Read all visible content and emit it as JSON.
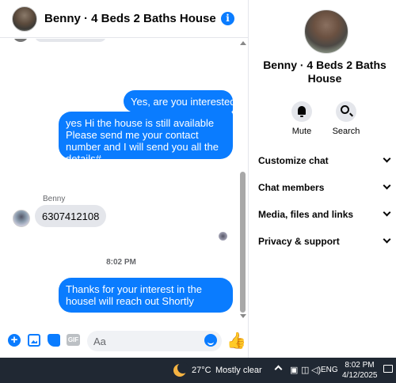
{
  "chat": {
    "title": "Benny · 4 Beds 2 Baths House",
    "messages": [
      {
        "text": "Yes, are you interested?"
      },
      {
        "text": "yes Hi the house is still available Please send me your contact number and I will send you all the details#"
      }
    ],
    "sender_name": "Benny",
    "incoming_text": "6307412108",
    "time_separator": "8:02 PM",
    "last_outgoing": "Thanks for your interest in the housel will reach out Shortly",
    "composer_placeholder": "Aa",
    "gif_label": "GIF",
    "plus_glyph": "+",
    "info_glyph": "i",
    "like_glyph": "👍"
  },
  "info_panel": {
    "name": "Benny · 4 Beds 2 Baths House",
    "actions": {
      "mute": "Mute",
      "search": "Search"
    },
    "menu": [
      "Customize chat",
      "Chat members",
      "Media, files and links",
      "Privacy & support"
    ]
  },
  "taskbar": {
    "temperature": "27°C",
    "condition": "Mostly clear",
    "language": "ENG",
    "time": "8:02 PM",
    "date": "4/12/2025",
    "tray_icons": [
      "camera-icon",
      "network-icon",
      "volume-icon"
    ]
  },
  "colors": {
    "accent": "#0a7cff",
    "bubble_in": "#e4e6eb",
    "taskbar": "#202833"
  }
}
